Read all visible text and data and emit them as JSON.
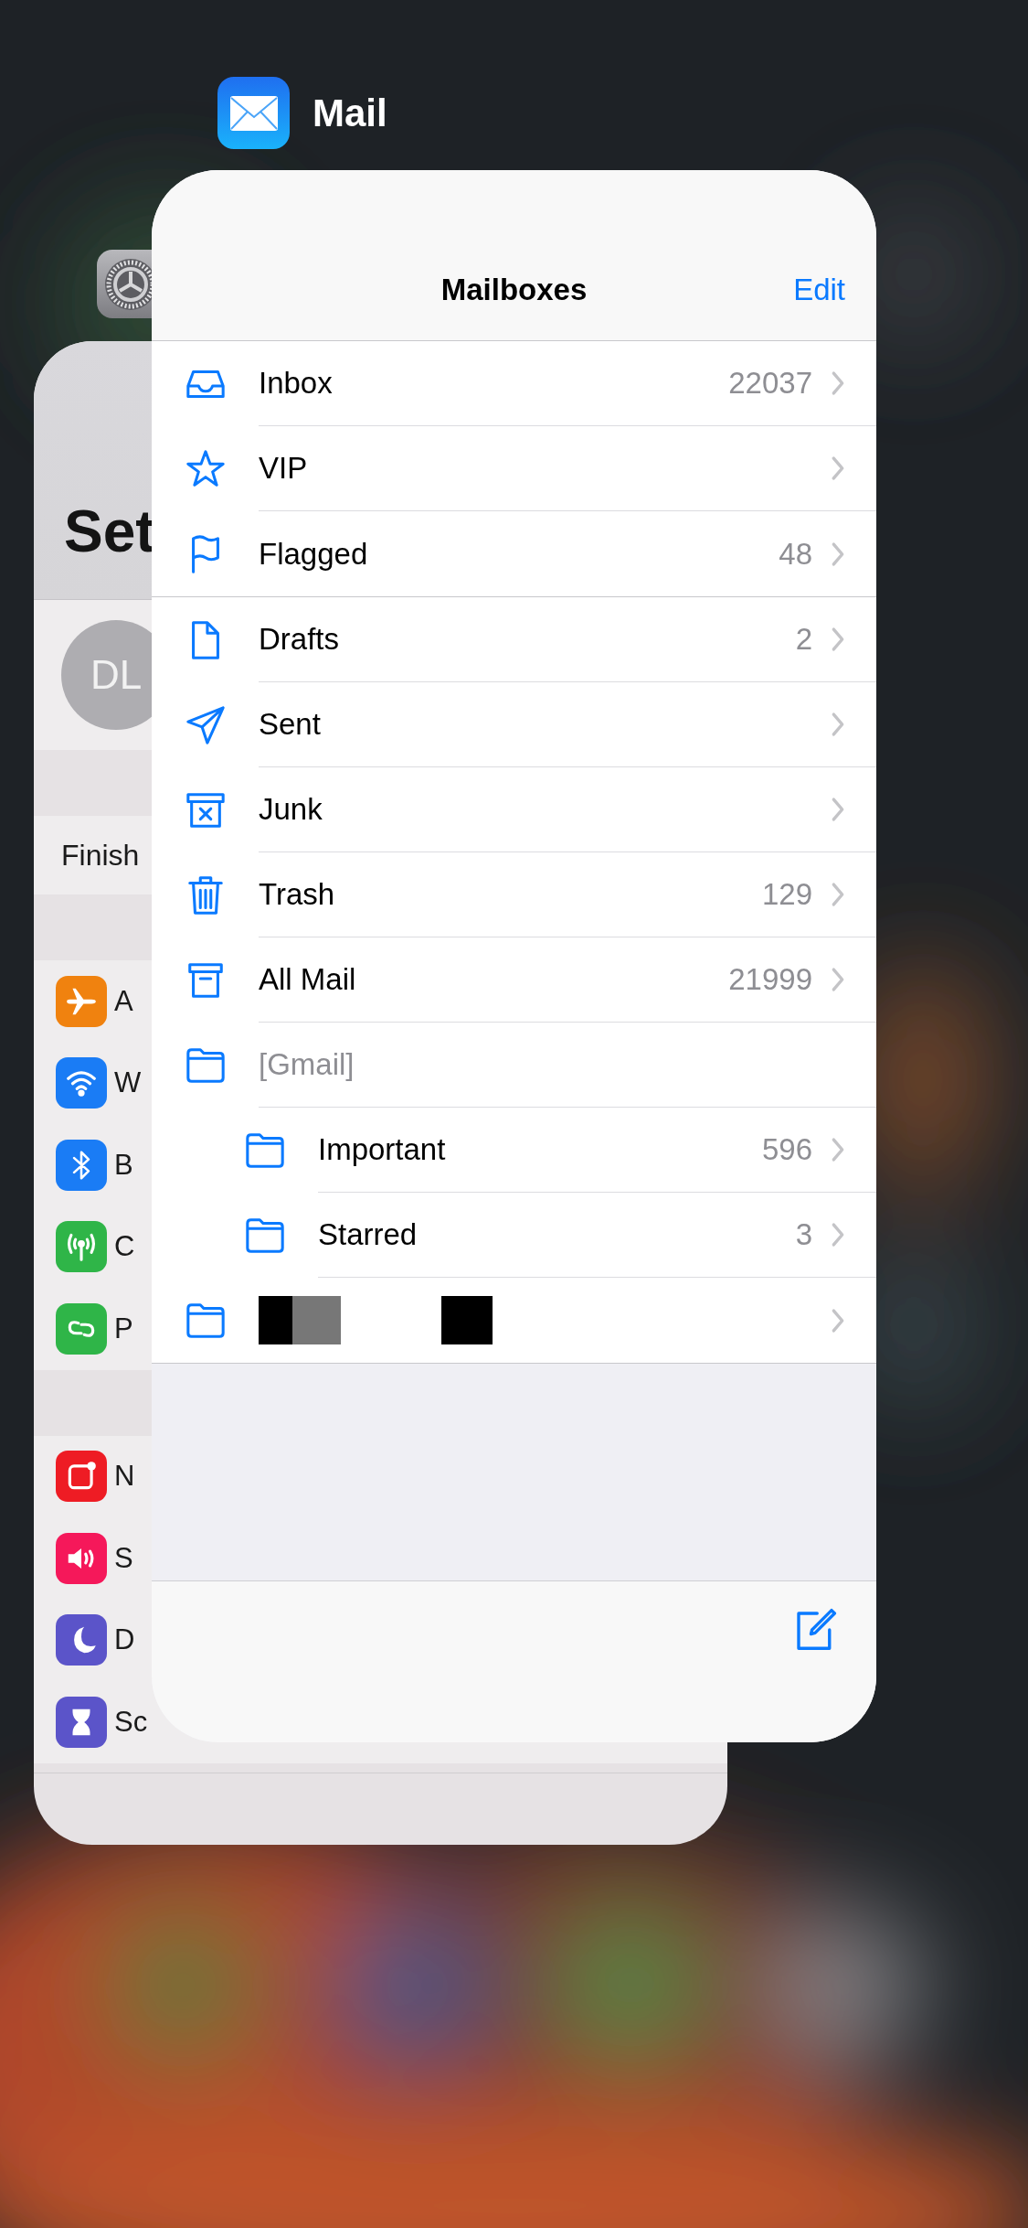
{
  "app_label": {
    "title": "Mail"
  },
  "settings_card": {
    "title": "Set",
    "profile": {
      "initials": "DL"
    },
    "banner": "Finish",
    "groups": [
      [
        {
          "kind": "airplane",
          "color": "#f0820f",
          "label": "A"
        },
        {
          "kind": "wifi",
          "color": "#1a7cf5",
          "label": "W"
        },
        {
          "kind": "bluetooth",
          "color": "#1a7cf5",
          "label": "B"
        },
        {
          "kind": "cellular",
          "color": "#2fb548",
          "label": "C"
        },
        {
          "kind": "hotspot",
          "color": "#2fb548",
          "label": "P"
        }
      ],
      [
        {
          "kind": "notifications",
          "color": "#ee1c24",
          "label": "N"
        },
        {
          "kind": "sounds",
          "color": "#f5185a",
          "label": "S"
        },
        {
          "kind": "moon",
          "color": "#5b54c9",
          "label": "D"
        },
        {
          "kind": "hourglass",
          "color": "#5b54c9",
          "label": "Sc"
        }
      ]
    ]
  },
  "mail_card": {
    "title": "Mailboxes",
    "edit": "Edit",
    "sections": [
      {
        "rows": [
          {
            "kind": "inbox",
            "label": "Inbox",
            "count": "22037",
            "chevron": true
          },
          {
            "kind": "star",
            "label": "VIP",
            "chevron": true
          },
          {
            "kind": "flag",
            "label": "Flagged",
            "count": "48",
            "chevron": true
          }
        ]
      },
      {
        "rows": [
          {
            "kind": "doc",
            "label": "Drafts",
            "count": "2",
            "chevron": true
          },
          {
            "kind": "send",
            "label": "Sent",
            "chevron": true
          },
          {
            "kind": "junk",
            "label": "Junk",
            "chevron": true
          },
          {
            "kind": "trash",
            "label": "Trash",
            "count": "129",
            "chevron": true
          },
          {
            "kind": "archive",
            "label": "All Mail",
            "count": "21999",
            "chevron": true
          },
          {
            "kind": "folder",
            "label": "[Gmail]",
            "chevron": false,
            "children": [
              {
                "kind": "folder",
                "label": "Important",
                "count": "596",
                "chevron": true
              },
              {
                "kind": "folder",
                "label": "Starred",
                "count": "3",
                "chevron": true
              }
            ]
          },
          {
            "kind": "redacted",
            "chevron": true
          }
        ]
      }
    ]
  }
}
